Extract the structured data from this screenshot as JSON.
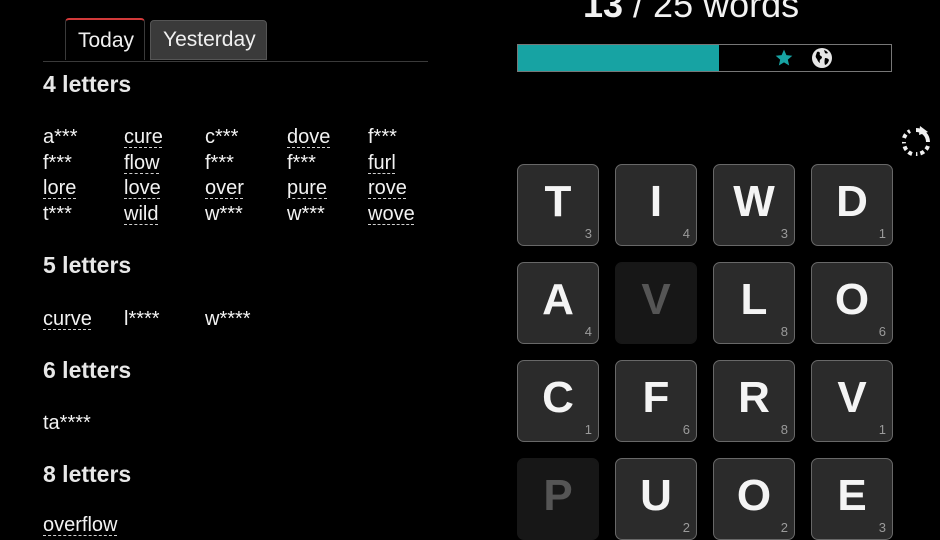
{
  "tabs": {
    "today": "Today",
    "yesterday": "Yesterday"
  },
  "sections": [
    {
      "title": "4 letters",
      "words": [
        [
          "a***",
          "cure",
          "c***",
          "dove",
          "f***"
        ],
        [
          "f***",
          "flow",
          "f***",
          "f***",
          "furl"
        ],
        [
          "lore",
          "love",
          "over",
          "pure",
          "rove"
        ],
        [
          "t***",
          "wild",
          "w***",
          "w***",
          "wove"
        ]
      ],
      "found": [
        [
          false,
          true,
          false,
          true,
          false
        ],
        [
          false,
          true,
          false,
          false,
          true
        ],
        [
          true,
          true,
          true,
          true,
          true
        ],
        [
          false,
          true,
          false,
          false,
          true
        ]
      ]
    },
    {
      "title": "5 letters",
      "words": [
        [
          "curve",
          "l****",
          "w****"
        ]
      ],
      "found": [
        [
          true,
          false,
          false
        ]
      ]
    },
    {
      "title": "6 letters",
      "words": [
        [
          "ta****"
        ]
      ],
      "found": [
        [
          false
        ]
      ]
    },
    {
      "title": "8 letters",
      "words": [
        [
          "overflow"
        ]
      ],
      "found": [
        [
          true
        ]
      ]
    }
  ],
  "score": {
    "found": "13",
    "rest": " / 25 words",
    "progress_fraction": 0.54
  },
  "icons": {
    "star": "star-icon",
    "globe": "globe-icon",
    "restart": "restart-icon"
  },
  "colors": {
    "accent": "#17a3a3",
    "tab_indicator": "#d23a3a"
  },
  "board": [
    [
      {
        "l": "T",
        "p": "3"
      },
      {
        "l": "I",
        "p": "4"
      },
      {
        "l": "W",
        "p": "3"
      },
      {
        "l": "D",
        "p": "1"
      }
    ],
    [
      {
        "l": "A",
        "p": "4"
      },
      {
        "l": "V",
        "p": "",
        "dim": true
      },
      {
        "l": "L",
        "p": "8"
      },
      {
        "l": "O",
        "p": "6"
      }
    ],
    [
      {
        "l": "C",
        "p": "1"
      },
      {
        "l": "F",
        "p": "6"
      },
      {
        "l": "R",
        "p": "8"
      },
      {
        "l": "V",
        "p": "1"
      }
    ],
    [
      {
        "l": "P",
        "p": "",
        "dim": true
      },
      {
        "l": "U",
        "p": "2"
      },
      {
        "l": "O",
        "p": "2"
      },
      {
        "l": "E",
        "p": "3"
      }
    ]
  ]
}
